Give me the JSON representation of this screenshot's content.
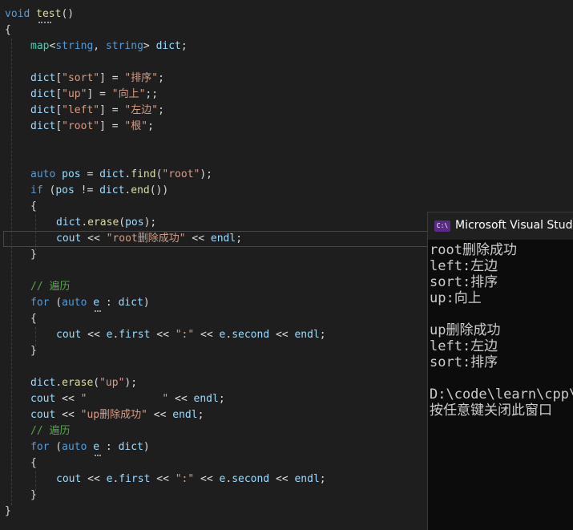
{
  "code": {
    "l1": {
      "kw": "void",
      "fn": "test",
      "rest": "()"
    },
    "l2": "{",
    "l3": {
      "ty1": "map",
      "p1": "<",
      "ty2": "string",
      "p2": ", ",
      "ty3": "string",
      "p3": "> ",
      "var": "dict",
      "end": ";"
    },
    "l5": {
      "var": "dict",
      "p1": "[",
      "s1": "\"sort\"",
      "p2": "] = ",
      "s2": "\"排序\"",
      "end": ";"
    },
    "l6": {
      "var": "dict",
      "p1": "[",
      "s1": "\"up\"",
      "p2": "] = ",
      "s2": "\"向上\"",
      "end": ";;"
    },
    "l7": {
      "var": "dict",
      "p1": "[",
      "s1": "\"left\"",
      "p2": "] = ",
      "s2": "\"左边\"",
      "end": ";"
    },
    "l8": {
      "var": "dict",
      "p1": "[",
      "s1": "\"root\"",
      "p2": "] = ",
      "s2": "\"根\"",
      "end": ";"
    },
    "l11": {
      "kw": "auto",
      "v1": "pos",
      "p1": " = ",
      "v2": "dict",
      "p2": ".",
      "fn": "find",
      "p3": "(",
      "s": "\"root\"",
      "end": ");"
    },
    "l12": {
      "kw": "if",
      "p1": " (",
      "v1": "pos",
      "p2": " != ",
      "v2": "dict",
      "p3": ".",
      "fn": "end",
      "end": "())"
    },
    "l13": "{",
    "l14": {
      "v": "dict",
      "p1": ".",
      "fn": "erase",
      "p2": "(",
      "v2": "pos",
      "end": ");"
    },
    "l15": {
      "v": "cout",
      "p1": " << ",
      "s": "\"root删除成功\"",
      "p2": " << ",
      "v2": "endl",
      "end": ";"
    },
    "l16": "}",
    "l18": "// 遍历",
    "l19": {
      "kw1": "for",
      "p1": " (",
      "kw2": "auto",
      "p2": " ",
      "v": "e",
      "p3": " : ",
      "v2": "dict",
      "end": ")"
    },
    "l20": "{",
    "l21": {
      "v": "cout",
      "p1": " << ",
      "v2": "e",
      "p2": ".",
      "v3": "first",
      "p3": " << ",
      "s": "\":\"",
      "p4": " << ",
      "v4": "e",
      "p5": ".",
      "v5": "second",
      "p6": " << ",
      "v6": "endl",
      "end": ";"
    },
    "l22": "}",
    "l24": {
      "v": "dict",
      "p1": ".",
      "fn": "erase",
      "p2": "(",
      "s": "\"up\"",
      "end": ");"
    },
    "l25": {
      "v": "cout",
      "p1": " << ",
      "s": "\"            \"",
      "p2": " << ",
      "v2": "endl",
      "end": ";"
    },
    "l26": {
      "v": "cout",
      "p1": " << ",
      "s": "\"up删除成功\"",
      "p2": " << ",
      "v2": "endl",
      "end": ";"
    },
    "l27": "// 遍历",
    "l28": {
      "kw1": "for",
      "p1": " (",
      "kw2": "auto",
      "p2": " ",
      "v": "e",
      "p3": " : ",
      "v2": "dict",
      "end": ")"
    },
    "l29": "{",
    "l30": {
      "v": "cout",
      "p1": " << ",
      "v2": "e",
      "p2": ".",
      "v3": "first",
      "p3": " << ",
      "s": "\":\"",
      "p4": " << ",
      "v4": "e",
      "p5": ".",
      "v5": "second",
      "p6": " << ",
      "v6": "endl",
      "end": ";"
    },
    "l31": "}",
    "l32": "}"
  },
  "console": {
    "title": "Microsoft Visual Studio",
    "icon": "console-app-icon",
    "lines": [
      "root删除成功",
      "left:左边",
      "sort:排序",
      "up:向上",
      "",
      "up删除成功",
      "left:左边",
      "sort:排序",
      "",
      "D:\\code\\learn\\cpp\\",
      "按任意键关闭此窗口"
    ]
  }
}
